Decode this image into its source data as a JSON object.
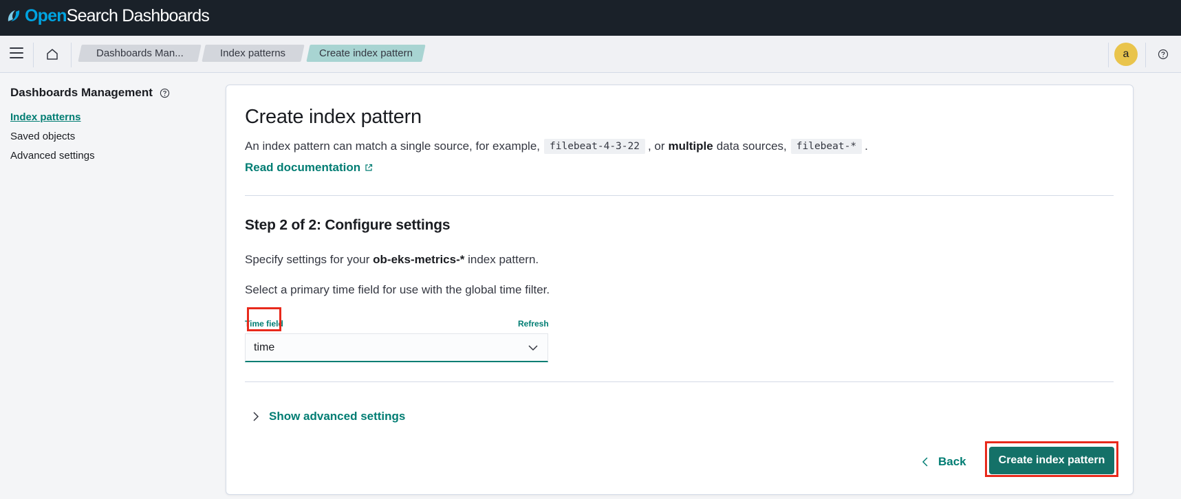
{
  "app": {
    "brand_open": "Open",
    "brand_rest": "Search Dashboards",
    "logo_icon": "opensearch-logo-icon"
  },
  "header": {
    "menu_icon": "hamburger-menu-icon",
    "home_icon": "home-icon",
    "breadcrumbs": [
      {
        "label": "Dashboards Man..."
      },
      {
        "label": "Index patterns"
      },
      {
        "label": "Create index pattern"
      }
    ],
    "avatar_initial": "a",
    "help_icon": "help-icon"
  },
  "sidebar": {
    "title": "Dashboards Management",
    "items": [
      {
        "label": "Index patterns",
        "active": true
      },
      {
        "label": "Saved objects",
        "active": false
      },
      {
        "label": "Advanced settings",
        "active": false
      }
    ]
  },
  "main": {
    "title": "Create index pattern",
    "description": {
      "part1": "An index pattern can match a single source, for example,",
      "code1": "filebeat-4-3-22",
      "part2": ", or",
      "bold": "multiple",
      "part3": "data sources,",
      "code2": "filebeat-*",
      "part4": "."
    },
    "doc_link": "Read documentation",
    "step_title": "Step 2 of 2: Configure settings",
    "specify": {
      "before": "Specify settings for your",
      "pattern": "ob-eks-metrics-*",
      "after": "index pattern."
    },
    "select_hint": "Select a primary time field for use with the global time filter.",
    "time_field": {
      "label": "Time field",
      "refresh": "Refresh",
      "value": "time"
    },
    "advanced_toggle": "Show advanced settings",
    "back_button": "Back",
    "create_button": "Create index pattern"
  },
  "colors": {
    "accent": "#017d73",
    "primary_button": "#147168",
    "highlight": "#e8291b",
    "header_bg": "#1a2129",
    "avatar_bg": "#e9c44c"
  }
}
